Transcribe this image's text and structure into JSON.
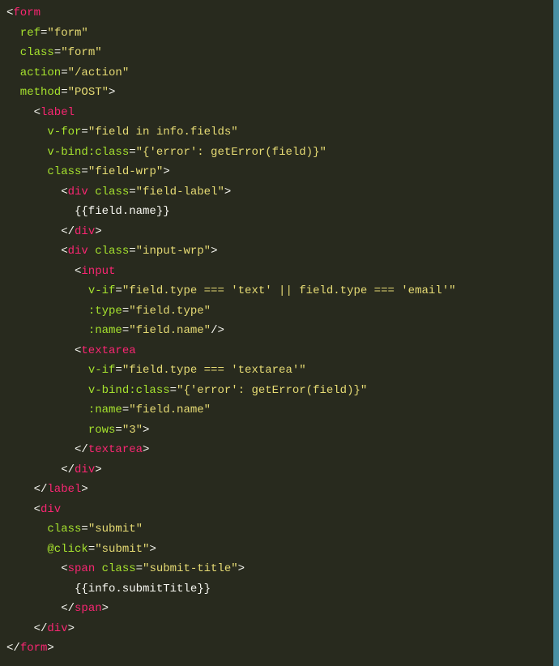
{
  "code": {
    "lines": [
      {
        "indent": 0,
        "tokens": [
          {
            "t": "punct",
            "v": "<"
          },
          {
            "t": "tag",
            "v": "form"
          }
        ]
      },
      {
        "indent": 1,
        "tokens": [
          {
            "t": "attr",
            "v": "ref"
          },
          {
            "t": "op",
            "v": "="
          },
          {
            "t": "str",
            "v": "\"form\""
          }
        ]
      },
      {
        "indent": 1,
        "tokens": [
          {
            "t": "attr",
            "v": "class"
          },
          {
            "t": "op",
            "v": "="
          },
          {
            "t": "str",
            "v": "\"form\""
          }
        ]
      },
      {
        "indent": 1,
        "tokens": [
          {
            "t": "attr",
            "v": "action"
          },
          {
            "t": "op",
            "v": "="
          },
          {
            "t": "str",
            "v": "\"/action\""
          }
        ]
      },
      {
        "indent": 1,
        "tokens": [
          {
            "t": "attr",
            "v": "method"
          },
          {
            "t": "op",
            "v": "="
          },
          {
            "t": "str",
            "v": "\"POST\""
          },
          {
            "t": "punct",
            "v": ">"
          }
        ]
      },
      {
        "indent": 2,
        "tokens": [
          {
            "t": "punct",
            "v": "<"
          },
          {
            "t": "tag",
            "v": "label"
          }
        ]
      },
      {
        "indent": 3,
        "tokens": [
          {
            "t": "attr",
            "v": "v-for"
          },
          {
            "t": "op",
            "v": "="
          },
          {
            "t": "str",
            "v": "\"field in info.fields\""
          }
        ]
      },
      {
        "indent": 3,
        "tokens": [
          {
            "t": "attr",
            "v": "v-bind:class"
          },
          {
            "t": "op",
            "v": "="
          },
          {
            "t": "str",
            "v": "\"{'error': getError(field)}\""
          }
        ]
      },
      {
        "indent": 3,
        "tokens": [
          {
            "t": "attr",
            "v": "class"
          },
          {
            "t": "op",
            "v": "="
          },
          {
            "t": "str",
            "v": "\"field-wrp\""
          },
          {
            "t": "punct",
            "v": ">"
          }
        ]
      },
      {
        "indent": 4,
        "tokens": [
          {
            "t": "punct",
            "v": "<"
          },
          {
            "t": "tag",
            "v": "div"
          },
          {
            "t": "punct",
            "v": " "
          },
          {
            "t": "attr",
            "v": "class"
          },
          {
            "t": "op",
            "v": "="
          },
          {
            "t": "str",
            "v": "\"field-label\""
          },
          {
            "t": "punct",
            "v": ">"
          }
        ]
      },
      {
        "indent": 5,
        "tokens": [
          {
            "t": "punct",
            "v": "{{field.name}}"
          }
        ]
      },
      {
        "indent": 4,
        "tokens": [
          {
            "t": "punct",
            "v": "</"
          },
          {
            "t": "tag",
            "v": "div"
          },
          {
            "t": "punct",
            "v": ">"
          }
        ]
      },
      {
        "indent": 4,
        "tokens": [
          {
            "t": "punct",
            "v": "<"
          },
          {
            "t": "tag",
            "v": "div"
          },
          {
            "t": "punct",
            "v": " "
          },
          {
            "t": "attr",
            "v": "class"
          },
          {
            "t": "op",
            "v": "="
          },
          {
            "t": "str",
            "v": "\"input-wrp\""
          },
          {
            "t": "punct",
            "v": ">"
          }
        ]
      },
      {
        "indent": 5,
        "tokens": [
          {
            "t": "punct",
            "v": "<"
          },
          {
            "t": "tag",
            "v": "input"
          }
        ]
      },
      {
        "indent": 6,
        "tokens": [
          {
            "t": "attr",
            "v": "v-if"
          },
          {
            "t": "op",
            "v": "="
          },
          {
            "t": "str",
            "v": "\"field.type === 'text' || field.type === 'email'\""
          }
        ]
      },
      {
        "indent": 6,
        "tokens": [
          {
            "t": "attr",
            "v": ":type"
          },
          {
            "t": "op",
            "v": "="
          },
          {
            "t": "str",
            "v": "\"field.type\""
          }
        ]
      },
      {
        "indent": 6,
        "tokens": [
          {
            "t": "attr",
            "v": ":name"
          },
          {
            "t": "op",
            "v": "="
          },
          {
            "t": "str",
            "v": "\"field.name\""
          },
          {
            "t": "punct",
            "v": "/>"
          }
        ]
      },
      {
        "indent": 5,
        "tokens": [
          {
            "t": "punct",
            "v": "<"
          },
          {
            "t": "tag",
            "v": "textarea"
          }
        ]
      },
      {
        "indent": 6,
        "tokens": [
          {
            "t": "attr",
            "v": "v-if"
          },
          {
            "t": "op",
            "v": "="
          },
          {
            "t": "str",
            "v": "\"field.type === 'textarea'\""
          }
        ]
      },
      {
        "indent": 6,
        "tokens": [
          {
            "t": "attr",
            "v": "v-bind:class"
          },
          {
            "t": "op",
            "v": "="
          },
          {
            "t": "str",
            "v": "\"{'error': getError(field)}\""
          }
        ]
      },
      {
        "indent": 6,
        "tokens": [
          {
            "t": "attr",
            "v": ":name"
          },
          {
            "t": "op",
            "v": "="
          },
          {
            "t": "str",
            "v": "\"field.name\""
          }
        ]
      },
      {
        "indent": 6,
        "tokens": [
          {
            "t": "attr",
            "v": "rows"
          },
          {
            "t": "op",
            "v": "="
          },
          {
            "t": "str",
            "v": "\"3\""
          },
          {
            "t": "punct",
            "v": ">"
          }
        ]
      },
      {
        "indent": 5,
        "tokens": [
          {
            "t": "punct",
            "v": "</"
          },
          {
            "t": "tag",
            "v": "textarea"
          },
          {
            "t": "punct",
            "v": ">"
          }
        ]
      },
      {
        "indent": 4,
        "tokens": [
          {
            "t": "punct",
            "v": "</"
          },
          {
            "t": "tag",
            "v": "div"
          },
          {
            "t": "punct",
            "v": ">"
          }
        ]
      },
      {
        "indent": 2,
        "tokens": [
          {
            "t": "punct",
            "v": "</"
          },
          {
            "t": "tag",
            "v": "label"
          },
          {
            "t": "punct",
            "v": ">"
          }
        ]
      },
      {
        "indent": 2,
        "tokens": [
          {
            "t": "punct",
            "v": "<"
          },
          {
            "t": "tag",
            "v": "div"
          }
        ]
      },
      {
        "indent": 3,
        "tokens": [
          {
            "t": "attr",
            "v": "class"
          },
          {
            "t": "op",
            "v": "="
          },
          {
            "t": "str",
            "v": "\"submit\""
          }
        ]
      },
      {
        "indent": 3,
        "tokens": [
          {
            "t": "attr",
            "v": "@click"
          },
          {
            "t": "op",
            "v": "="
          },
          {
            "t": "str",
            "v": "\"submit\""
          },
          {
            "t": "punct",
            "v": ">"
          }
        ]
      },
      {
        "indent": 4,
        "tokens": [
          {
            "t": "punct",
            "v": "<"
          },
          {
            "t": "tag",
            "v": "span"
          },
          {
            "t": "punct",
            "v": " "
          },
          {
            "t": "attr",
            "v": "class"
          },
          {
            "t": "op",
            "v": "="
          },
          {
            "t": "str",
            "v": "\"submit-title\""
          },
          {
            "t": "punct",
            "v": ">"
          }
        ]
      },
      {
        "indent": 5,
        "tokens": [
          {
            "t": "punct",
            "v": "{{info.submitTitle}}"
          }
        ]
      },
      {
        "indent": 4,
        "tokens": [
          {
            "t": "punct",
            "v": "</"
          },
          {
            "t": "tag",
            "v": "span"
          },
          {
            "t": "punct",
            "v": ">"
          }
        ]
      },
      {
        "indent": 2,
        "tokens": [
          {
            "t": "punct",
            "v": "</"
          },
          {
            "t": "tag",
            "v": "div"
          },
          {
            "t": "punct",
            "v": ">"
          }
        ]
      },
      {
        "indent": 0,
        "tokens": [
          {
            "t": "punct",
            "v": "</"
          },
          {
            "t": "tag",
            "v": "form"
          },
          {
            "t": "punct",
            "v": ">"
          }
        ]
      }
    ]
  }
}
